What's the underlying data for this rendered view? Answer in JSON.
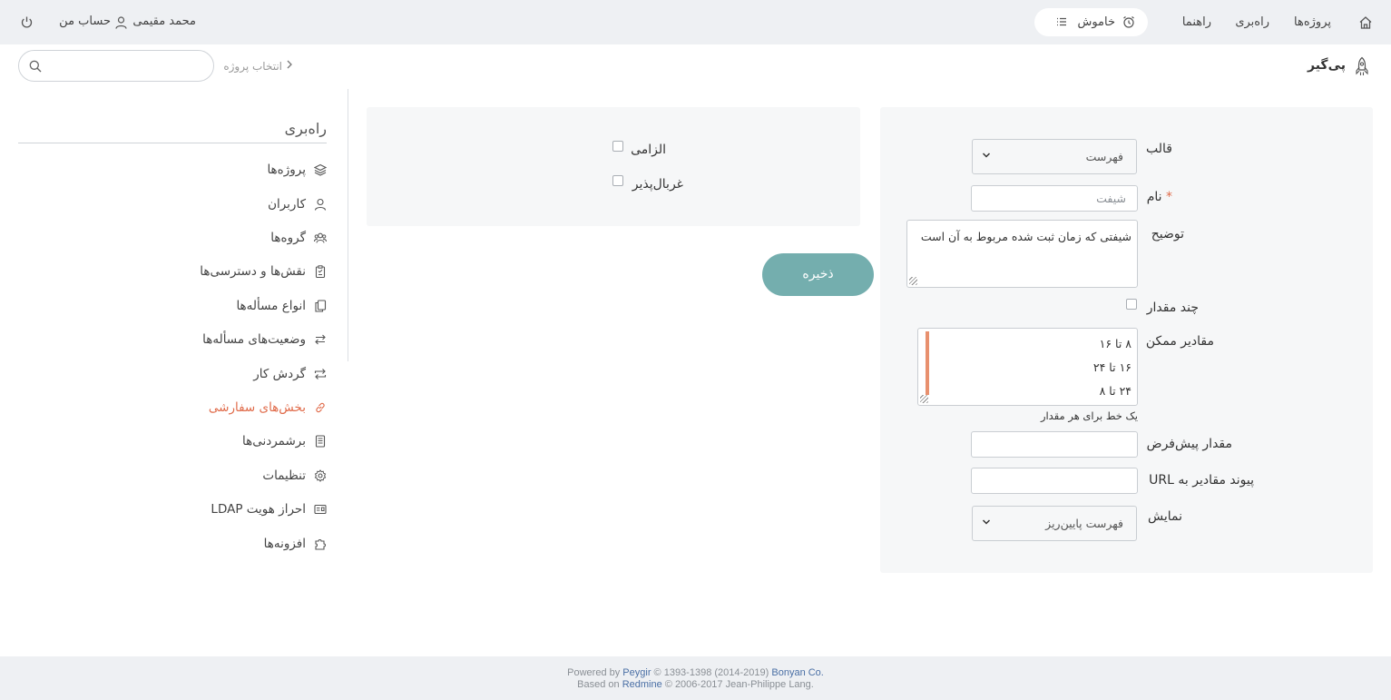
{
  "topbar": {
    "nav": [
      "پروژه‌ها",
      "راه‌بری",
      "راهنما"
    ],
    "clock_label": "خاموش",
    "user_name": "محمد مقیمی",
    "account_label": "حساب من"
  },
  "header": {
    "app_name": "پی‌گیر",
    "project_selector": "انتخاب پروژه",
    "search_placeholder": ""
  },
  "sidebar": {
    "title": "راه‌بری",
    "items": [
      {
        "label": "پروژه‌ها",
        "icon": "layers-icon"
      },
      {
        "label": "کاربران",
        "icon": "user-icon"
      },
      {
        "label": "گروه‌ها",
        "icon": "group-icon"
      },
      {
        "label": "نقش‌ها و دسترسی‌ها",
        "icon": "clipboard-icon"
      },
      {
        "label": "انواع مسأله‌ها",
        "icon": "copy-icon"
      },
      {
        "label": "وضعیت‌های مسأله‌ها",
        "icon": "swap-icon"
      },
      {
        "label": "گردش کار",
        "icon": "cycle-icon"
      },
      {
        "label": "بخش‌های سفارشی",
        "icon": "link-icon"
      },
      {
        "label": "برشمردنی‌ها",
        "icon": "list-icon"
      },
      {
        "label": "تنظیمات",
        "icon": "gear-icon"
      },
      {
        "label": "احراز هویت LDAP",
        "icon": "id-card-icon"
      },
      {
        "label": "افزونه‌ها",
        "icon": "puzzle-icon"
      }
    ],
    "active_index": 7
  },
  "form": {
    "format_label": "قالب",
    "format_value": "فهرست",
    "name_label": "نام",
    "required_mark": "*",
    "name_value": "شیفت",
    "description_label": "توضیح",
    "description_value": "شیفتی که زمان ثبت شده مربوط به آن است",
    "multiple_label": "چند مقدار",
    "possible_values_label": "مقادیر ممکن",
    "possible_values": [
      "۸ تا ۱۶",
      "۱۶ تا ۲۴",
      "۲۴ تا ۸"
    ],
    "possible_values_hint": "یک خط برای هر مقدار",
    "default_value_label": "مقدار پیش‌فرض",
    "default_value": "",
    "url_label": "پیوند مقادیر به URL",
    "url_value": "",
    "display_label": "نمایش",
    "display_value": "فهرست پایین‌ریز",
    "required_checkbox_label": "الزامی",
    "filter_checkbox_label": "غربال‌پذیر",
    "save_label": "ذخیره"
  },
  "footer": {
    "powered_by": "Powered by",
    "peygir_link": "Peygir",
    "copyright_1": "© 1393-1398 (2014-2019)",
    "company_link": "Bonyan Co.",
    "based_on": "Based on",
    "redmine_link": "Redmine",
    "copyright_2": "© 2006-2017 Jean-Philippe Lang."
  },
  "colors": {
    "accent": "#e06b4a",
    "save_button": "#74aeae",
    "bar_bg": "#eef0f3"
  }
}
